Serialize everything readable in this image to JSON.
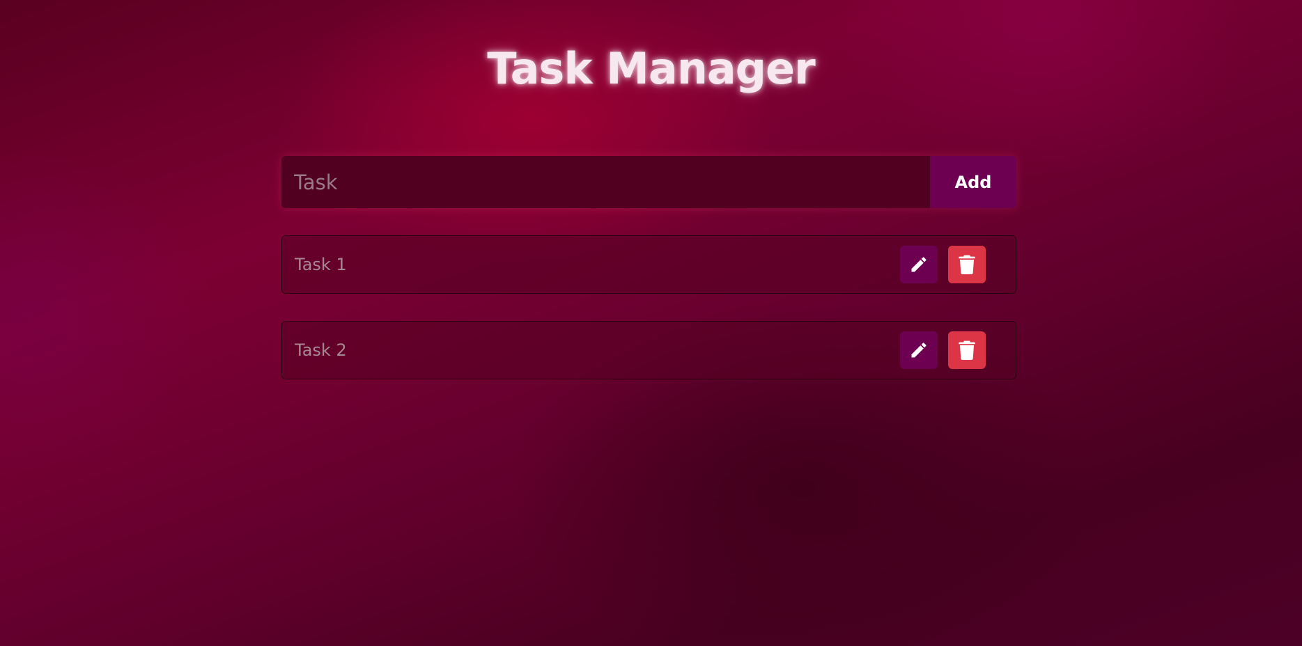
{
  "header": {
    "title": "Task Manager"
  },
  "form": {
    "placeholder": "Task",
    "value": "",
    "add_label": "Add"
  },
  "tasks": [
    {
      "text": "Task 1",
      "edit_icon": "pencil-icon",
      "delete_icon": "trash-icon"
    },
    {
      "text": "Task 2",
      "edit_icon": "pencil-icon",
      "delete_icon": "trash-icon"
    }
  ],
  "colors": {
    "accent": "#6e0052",
    "danger": "#dc3545",
    "input_bg": "#51001f",
    "background": "#7d0033"
  }
}
